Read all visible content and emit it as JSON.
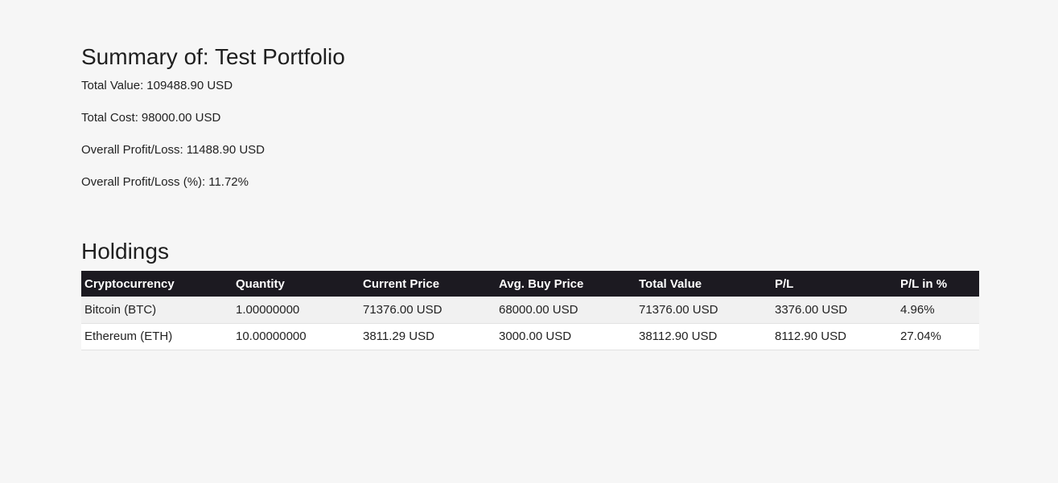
{
  "summary": {
    "title": "Summary of: Test Portfolio",
    "total_value": {
      "label": "Total Value:",
      "value": "109488.90 USD"
    },
    "total_cost": {
      "label": "Total Cost:",
      "value": "98000.00 USD"
    },
    "overall_pl": {
      "label": "Overall Profit/Loss:",
      "value": "11488.90 USD"
    },
    "overall_pl_pct": {
      "label": "Overall Profit/Loss (%):",
      "value": "11.72%"
    }
  },
  "holdings": {
    "title": "Holdings",
    "columns": [
      "Cryptocurrency",
      "Quantity",
      "Current Price",
      "Avg. Buy Price",
      "Total Value",
      "P/L",
      "P/L in %"
    ],
    "rows": [
      [
        "Bitcoin (BTC)",
        "1.00000000",
        "71376.00 USD",
        "68000.00 USD",
        "71376.00 USD",
        "3376.00 USD",
        "4.96%"
      ],
      [
        "Ethereum (ETH)",
        "10.00000000",
        "3811.29 USD",
        "3000.00 USD",
        "38112.90 USD",
        "8112.90 USD",
        "27.04%"
      ]
    ]
  }
}
